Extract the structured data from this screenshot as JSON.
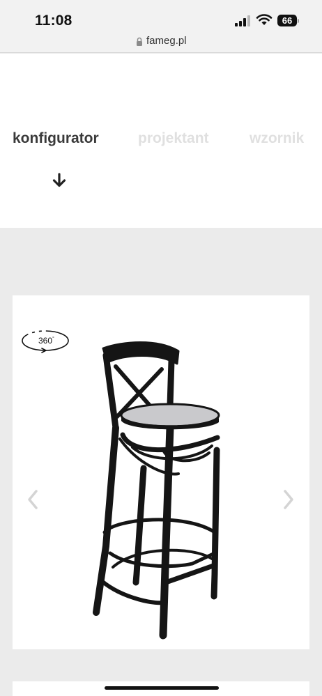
{
  "status_bar": {
    "time": "11:08",
    "battery_level": "66",
    "signal_icon": "cellular-signal-icon",
    "wifi_icon": "wifi-icon"
  },
  "browser": {
    "url": "fameg.pl",
    "lock_icon": "lock-icon"
  },
  "nav": {
    "tabs": [
      {
        "label": "konfigurator",
        "active": true
      },
      {
        "label": "projektant",
        "active": false
      },
      {
        "label": "wzornik",
        "active": false
      }
    ],
    "arrow_icon": "arrow-down-icon"
  },
  "product_viewer": {
    "rotate_label": "360",
    "rotate_degree": "°",
    "prev_icon": "chevron-left-icon",
    "next_icon": "chevron-right-icon",
    "image_icon": "bar-stool-image"
  },
  "colors": {
    "active_tab": "#3a3a3a",
    "inactive_tab": "#e0e0e0",
    "page_background": "#ebebeb",
    "card_background": "#ffffff",
    "stool_frame": "#151515",
    "stool_seat": "#c9c9cc"
  }
}
